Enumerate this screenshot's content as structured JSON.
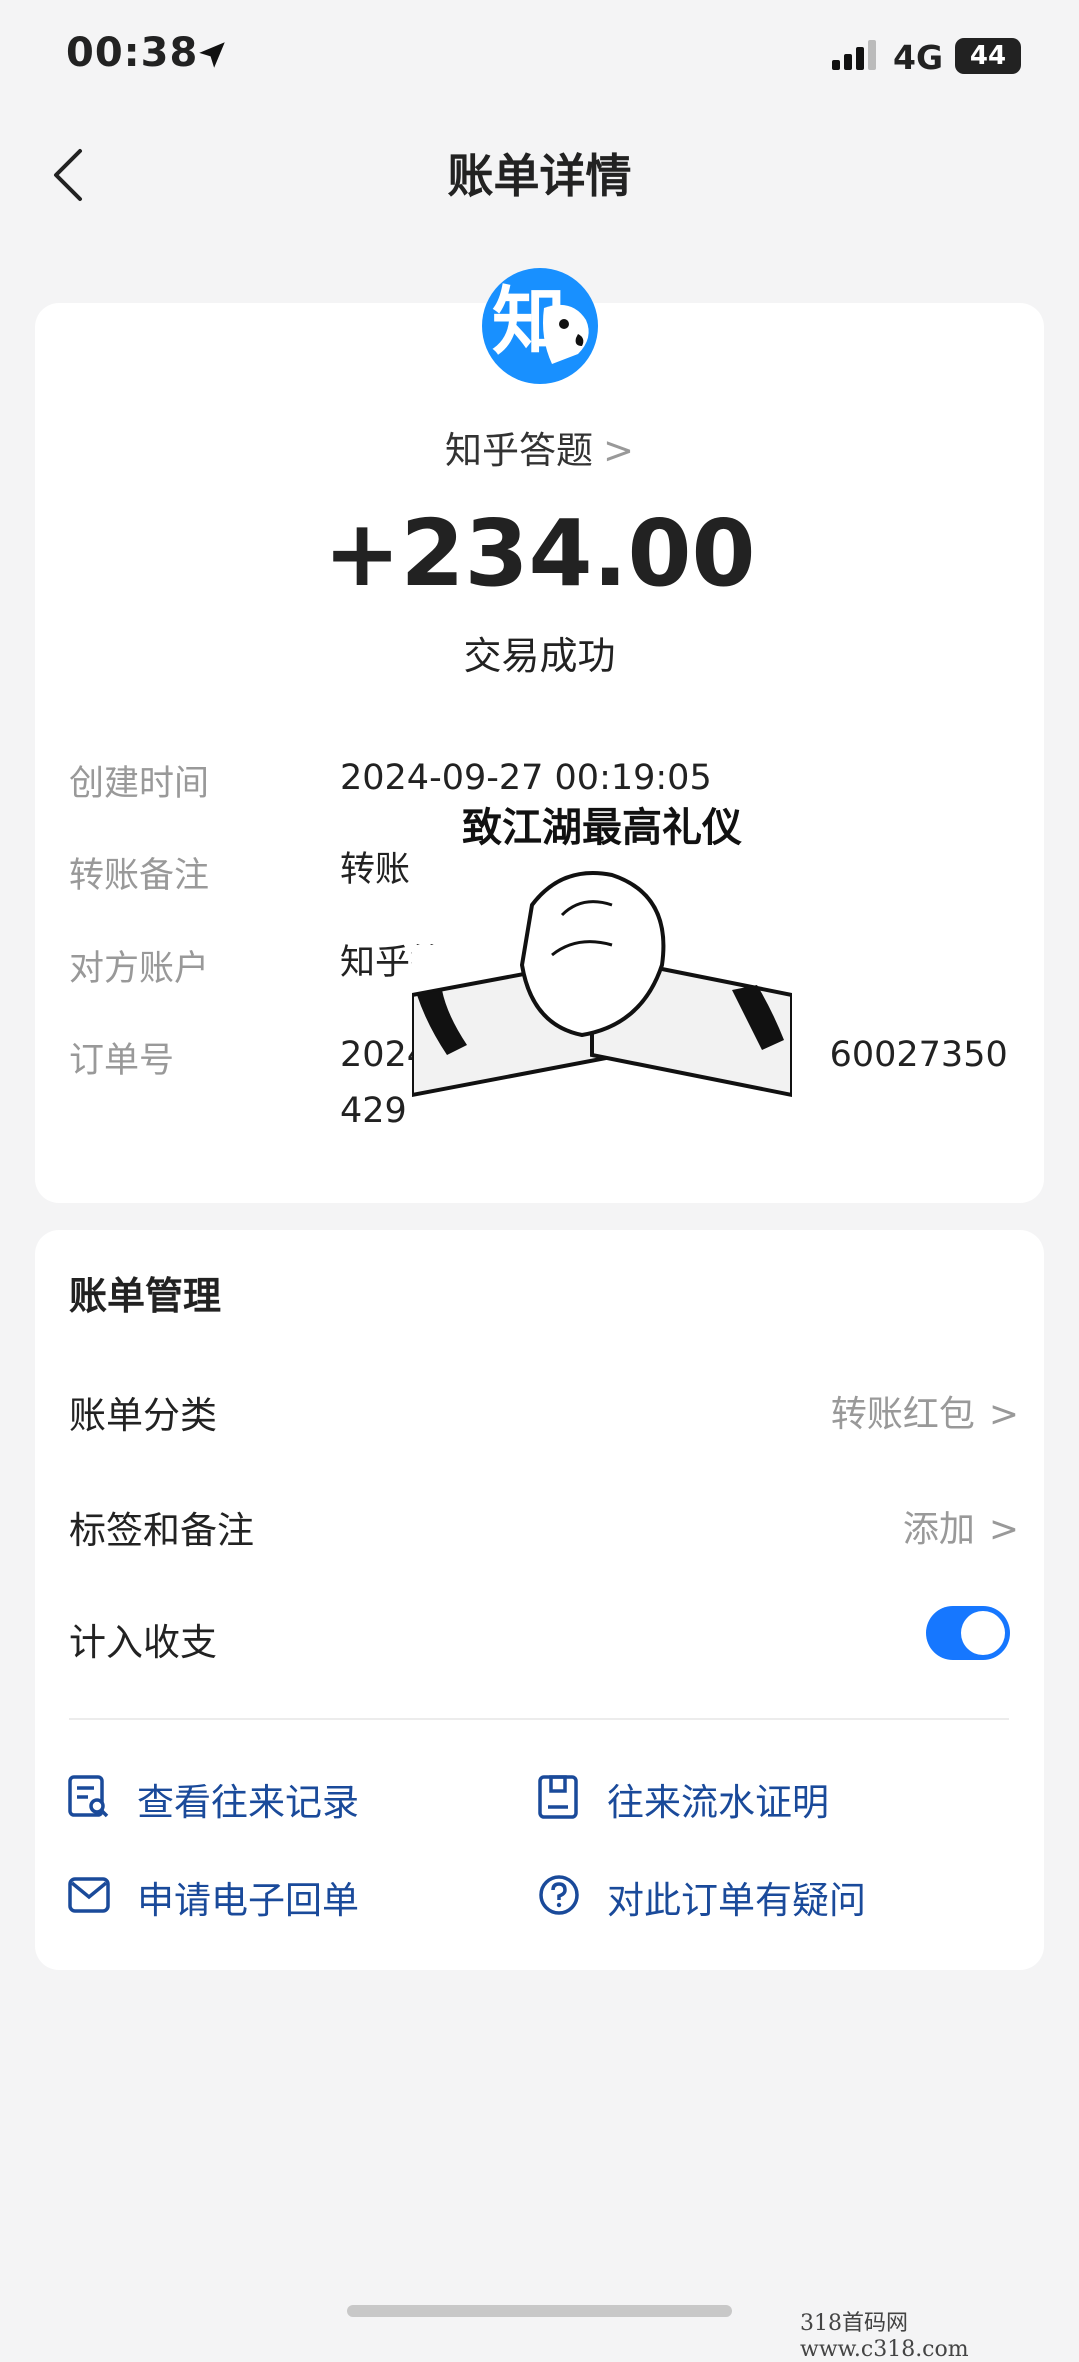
{
  "status_bar": {
    "time": "00:38",
    "network": "4G",
    "battery": "44"
  },
  "header": {
    "title": "账单详情"
  },
  "transaction": {
    "merchant": "知乎答题",
    "avatar_text": "知",
    "amount": "+234.00",
    "status": "交易成功",
    "rows": [
      {
        "label": "创建时间",
        "value": "2024-09-27 00:19:05"
      },
      {
        "label": "转账备注",
        "value": "转账"
      },
      {
        "label": "对方账户",
        "value": "知乎答题 19        15"
      },
      {
        "label": "订单号",
        "value": "2024                                    60027350429"
      }
    ],
    "sticker_caption": "致江湖最高礼仪"
  },
  "management": {
    "title": "账单管理",
    "items": [
      {
        "label": "账单分类",
        "value": "转账红包"
      },
      {
        "label": "标签和备注",
        "value": "添加"
      },
      {
        "label": "计入收支",
        "toggle": true
      }
    ],
    "actions": [
      {
        "label": "查看往来记录",
        "icon": "record-search-icon"
      },
      {
        "label": "往来流水证明",
        "icon": "document-icon"
      },
      {
        "label": "申请电子回单",
        "icon": "mail-icon"
      },
      {
        "label": "对此订单有疑问",
        "icon": "question-icon"
      }
    ]
  },
  "watermark": "318首码网   www.c318.com",
  "colors": {
    "accent": "#1677ff",
    "action_text": "#1a4a9a",
    "avatar_bg": "#1890ff"
  }
}
